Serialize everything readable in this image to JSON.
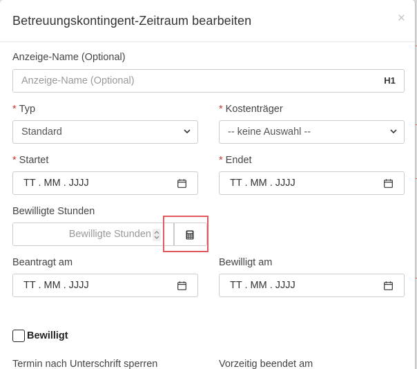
{
  "dialog": {
    "title": "Betreuungskontingent-Zeitraum bearbeiten",
    "close_symbol": "×"
  },
  "display_name": {
    "label": "Anzeige-Name (Optional)",
    "placeholder": "Anzeige-Name (Optional)",
    "addon": "H1"
  },
  "typ": {
    "required_mark": "*",
    "label": "Typ",
    "value": "Standard"
  },
  "kostentraeger": {
    "required_mark": "*",
    "label": "Kostenträger",
    "value": "-- keine Auswahl --"
  },
  "startet": {
    "required_mark": "*",
    "label": "Startet",
    "placeholder": "TT . MM . JJJJ"
  },
  "endet": {
    "required_mark": "*",
    "label": "Endet",
    "placeholder": "TT . MM . JJJJ"
  },
  "bewilligte_stunden": {
    "label": "Bewilligte Stunden",
    "placeholder": "Bewilligte Stunden"
  },
  "beantragt_am": {
    "label": "Beantragt am",
    "placeholder": "TT . MM . JJJJ"
  },
  "bewilligt_am": {
    "label": "Bewilligt am",
    "placeholder": "TT . MM . JJJJ"
  },
  "bewilligt_checkbox": {
    "label": "Bewilligt",
    "checked": false
  },
  "termin_sperren": {
    "label": "Termin nach Unterschrift sperren"
  },
  "vorzeitig_beendet": {
    "label": "Vorzeitig beendet am"
  },
  "colors": {
    "required": "#c0392b",
    "highlight": "#e0575e",
    "border": "#cccccc"
  },
  "icons": {
    "select": "chevron-down-icon",
    "date": "calendar-icon",
    "calculator": "calculator-icon",
    "close": "close-icon"
  }
}
